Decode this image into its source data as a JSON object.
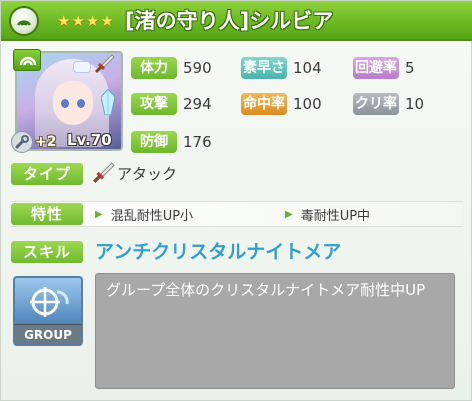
{
  "title": {
    "rarity_stars": 4,
    "character_name": "[渚の守り人]シルビア"
  },
  "portrait": {
    "plus": "+2",
    "level": "Lv.70"
  },
  "stats": {
    "hp": {
      "label": "体力",
      "value": "590"
    },
    "speed": {
      "label": "素早さ",
      "value": "104"
    },
    "evasion": {
      "label": "回避率",
      "value": "5"
    },
    "attack": {
      "label": "攻撃",
      "value": "294"
    },
    "accuracy": {
      "label": "命中率",
      "value": "100"
    },
    "critical": {
      "label": "クリ率",
      "value": "10"
    },
    "defense": {
      "label": "防御",
      "value": "176"
    }
  },
  "type": {
    "label": "タイプ",
    "value": "アタック",
    "icon": "sword-icon"
  },
  "traits": {
    "label": "特性",
    "items": [
      "混乱耐性UP小",
      "毒耐性UP中"
    ]
  },
  "skill": {
    "label": "スキル",
    "name": "アンチクリスタルナイトメア",
    "icon_label": "GROUP",
    "description": "グループ全体のクリスタルナイトメア耐性中UP"
  },
  "colors": {
    "accent_green": "#6cba22",
    "skill_name_blue": "#2f9fd0",
    "desc_box_gray": "#a8a8a8"
  }
}
